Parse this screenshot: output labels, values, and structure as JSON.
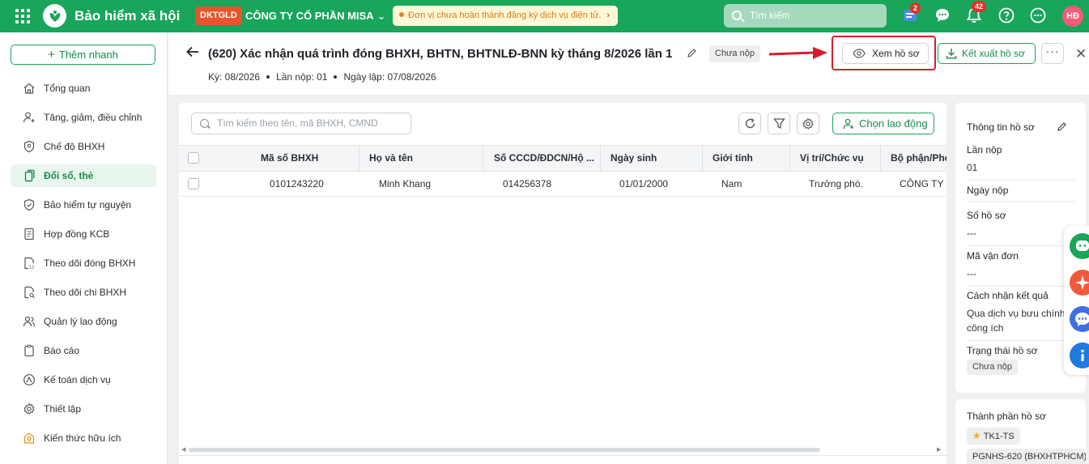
{
  "topbar": {
    "app_title": "Bảo hiểm xã hội",
    "tenant_code": "DKTGLD",
    "company_name": "CÔNG TY CỔ PHẦN MISA",
    "notice": "Đơn vị chưa hoàn thành đăng ký dịch vụ điện tử.",
    "search_placeholder": "Tìm kiếm",
    "cart_badge": "2",
    "notification_badge": "42",
    "avatar_initials": "HĐ",
    "brand_color": "#19a55a"
  },
  "sidebar": {
    "quick_add": "Thêm nhanh",
    "items": [
      {
        "label": "Tổng quan",
        "icon": "home-icon"
      },
      {
        "label": "Tăng, giảm, điều chỉnh",
        "icon": "user-adjust-icon"
      },
      {
        "label": "Chế độ BHXH",
        "icon": "shield-user-icon"
      },
      {
        "label": "Đổi sổ, thẻ",
        "icon": "card-swap-icon",
        "active": true
      },
      {
        "label": "Bảo hiểm tự nguyện",
        "icon": "shield-heart-icon"
      },
      {
        "label": "Hợp đồng KCB",
        "icon": "contract-icon"
      },
      {
        "label": "Theo dõi đóng BHXH",
        "icon": "calendar-doc-icon"
      },
      {
        "label": "Theo dõi chi BHXH",
        "icon": "doc-search-icon"
      },
      {
        "label": "Quản lý lao động",
        "icon": "users-icon"
      },
      {
        "label": "Báo cáo",
        "icon": "report-icon"
      },
      {
        "label": "Kế toán dịch vụ",
        "icon": "accounting-icon"
      },
      {
        "label": "Thiết lập",
        "icon": "gear-icon"
      },
      {
        "label": "Kiến thức hữu ích",
        "icon": "lightbulb-icon"
      }
    ]
  },
  "header": {
    "title": "(620) Xác nhận quá trình đóng BHXH, BHTN, BHTNLĐ-BNN kỳ tháng 8/2026 lần 1",
    "status": "Chưa nộp",
    "period": "Kỳ: 08/2026",
    "submission": "Lần nộp: 01",
    "created": "Ngày lập: 07/08/2026",
    "view_button": "Xem hồ sơ",
    "export_button": "Kết xuất hồ sơ"
  },
  "table": {
    "search_placeholder": "Tìm kiếm theo tên, mã BHXH, CMND",
    "choose_button": "Chọn lao động",
    "columns": [
      "Mã số BHXH",
      "Họ và tên",
      "Số CCCD/ĐDCN/Hộ ...",
      "Ngày sinh",
      "Giới tính",
      "Vị trí/Chức vụ",
      "Bộ phận/Phò"
    ],
    "rows": [
      [
        "0101243220",
        "Minh Khang",
        "014256378",
        "01/01/2000",
        "Nam",
        "Trưởng phò...",
        "CÔNG TY c"
      ]
    ]
  },
  "info": {
    "title": "Thông tin hồ sơ",
    "fields": [
      {
        "label": "Lần nộp",
        "value": "01"
      },
      {
        "label": "Ngày nộp",
        "value": ""
      },
      {
        "label": "Số hồ sơ",
        "value": "---"
      },
      {
        "label": "Mã vận đơn",
        "value": "---"
      },
      {
        "label": "Cách nhận kết quả",
        "value": "Qua dịch vụ bưu chính công ích"
      },
      {
        "label": "Trạng thái hồ sơ",
        "value": "Chưa nộp"
      }
    ],
    "components_title": "Thành phần hồ sơ",
    "components": [
      "TK1-TS",
      "PGNHS-620 (BHXHTPHCM)"
    ]
  }
}
